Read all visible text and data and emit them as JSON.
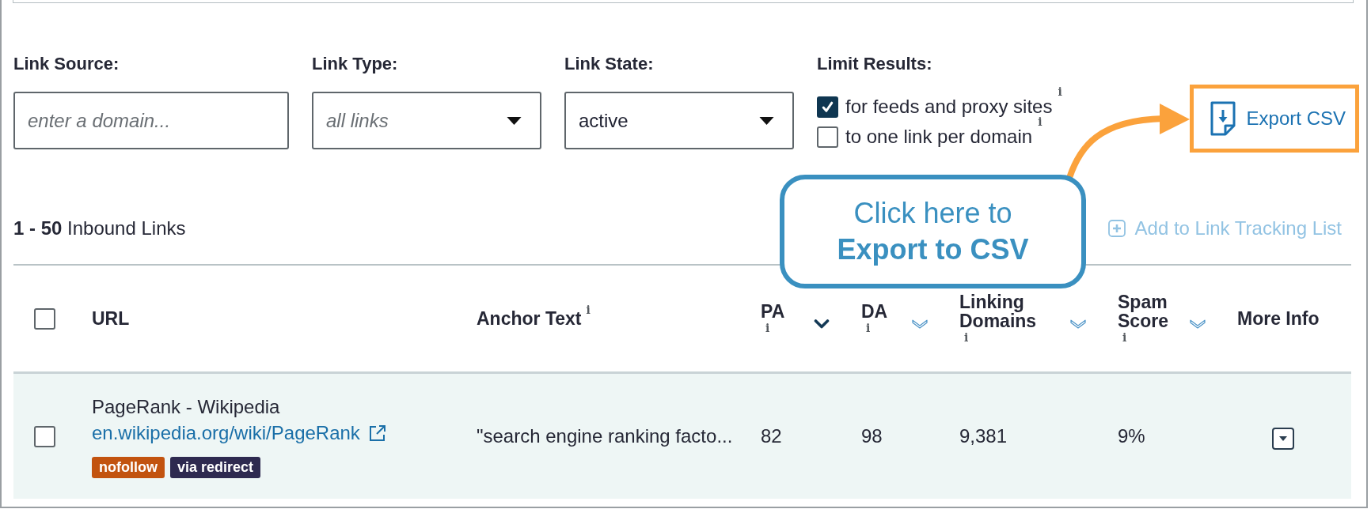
{
  "filters": [
    {
      "kind": "text",
      "label": "Link Source:",
      "placeholder": "enter a domain..."
    },
    {
      "kind": "select",
      "label": "Link Type:",
      "placeholder": "all links"
    },
    {
      "kind": "select",
      "label": "Link State:",
      "value": "active"
    }
  ],
  "limit_results": {
    "label": "Limit Results:",
    "options": [
      {
        "label": "for feeds and proxy sites",
        "info": "i",
        "checked": true
      },
      {
        "label": "to one link per domain",
        "info": "i",
        "checked": false
      }
    ]
  },
  "export_button": {
    "label": "Export CSV",
    "highlighted": true
  },
  "callout": {
    "text": "Click here to **Export to CSV**"
  },
  "results": {
    "summary": "**1 - 50** Inbound Links",
    "add_button": {
      "label": "Add to Link Tracking List",
      "disabled": true
    }
  },
  "table": {
    "select_all": {
      "checked": false
    },
    "columns": [
      {
        "kind": "text",
        "label": "URL"
      },
      {
        "kind": "text",
        "label": "Anchor Text",
        "info": "i"
      },
      {
        "kind": "metric",
        "label": "PA",
        "info": "i",
        "sorted": true
      },
      {
        "kind": "metric",
        "label": "DA",
        "info": "i",
        "sorted": false
      },
      {
        "kind": "metric",
        "label": "Linking Domains",
        "info": "i",
        "sorted": false
      },
      {
        "kind": "metric",
        "label": "Spam Score",
        "info": "i",
        "sorted": false
      },
      {
        "kind": "text",
        "label": "More Info"
      }
    ],
    "rows": [
      {
        "checked": false,
        "title": "PageRank - Wikipedia",
        "url": "en.wikipedia.org/wiki/PageRank",
        "tags": [
          {
            "label": "nofollow",
            "color": "#c2530f"
          },
          {
            "label": "via redirect",
            "color": "#2e2a50"
          }
        ],
        "anchor_text": "\"search engine ranking facto...",
        "pa": "82",
        "da": "98",
        "linking_domains": "9,381",
        "spam_score": "9%"
      }
    ]
  }
}
